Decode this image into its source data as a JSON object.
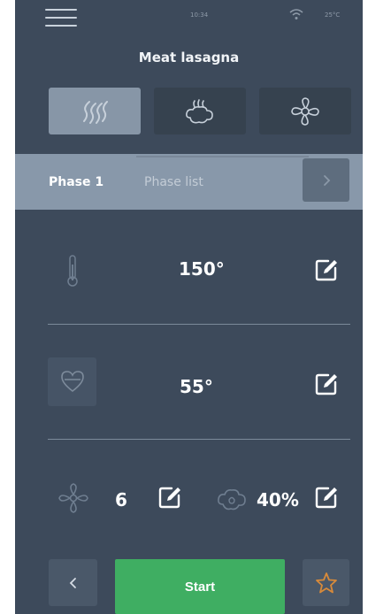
{
  "status": {
    "time": "10:34",
    "ambient": "25°C"
  },
  "recipe": {
    "title": "Meat lasagna"
  },
  "mode_tabs": [
    {
      "name": "convection",
      "icon": "heat-waves-icon",
      "active": true
    },
    {
      "name": "steam",
      "icon": "steam-icon",
      "active": false
    },
    {
      "name": "combi",
      "icon": "fan-flower-icon",
      "active": false
    }
  ],
  "phase": {
    "active_label": "Phase 1",
    "list_label": "Phase list"
  },
  "params": {
    "temperature": {
      "value": "150°",
      "icon": "thermometer-icon"
    },
    "core_probe": {
      "value": "55°",
      "icon": "heart-probe-icon"
    },
    "fan_speed": {
      "value": "6",
      "icon": "fan-icon"
    },
    "humidity": {
      "value": "40%",
      "icon": "humidity-icon"
    }
  },
  "footer": {
    "start_label": "Start",
    "back_icon": "chevron-left-icon",
    "favorite_icon": "star-icon"
  },
  "colors": {
    "background": "#3d4a5b",
    "phase_bar": "#8898aa",
    "start": "#3fae62",
    "star": "#d88a3a"
  }
}
